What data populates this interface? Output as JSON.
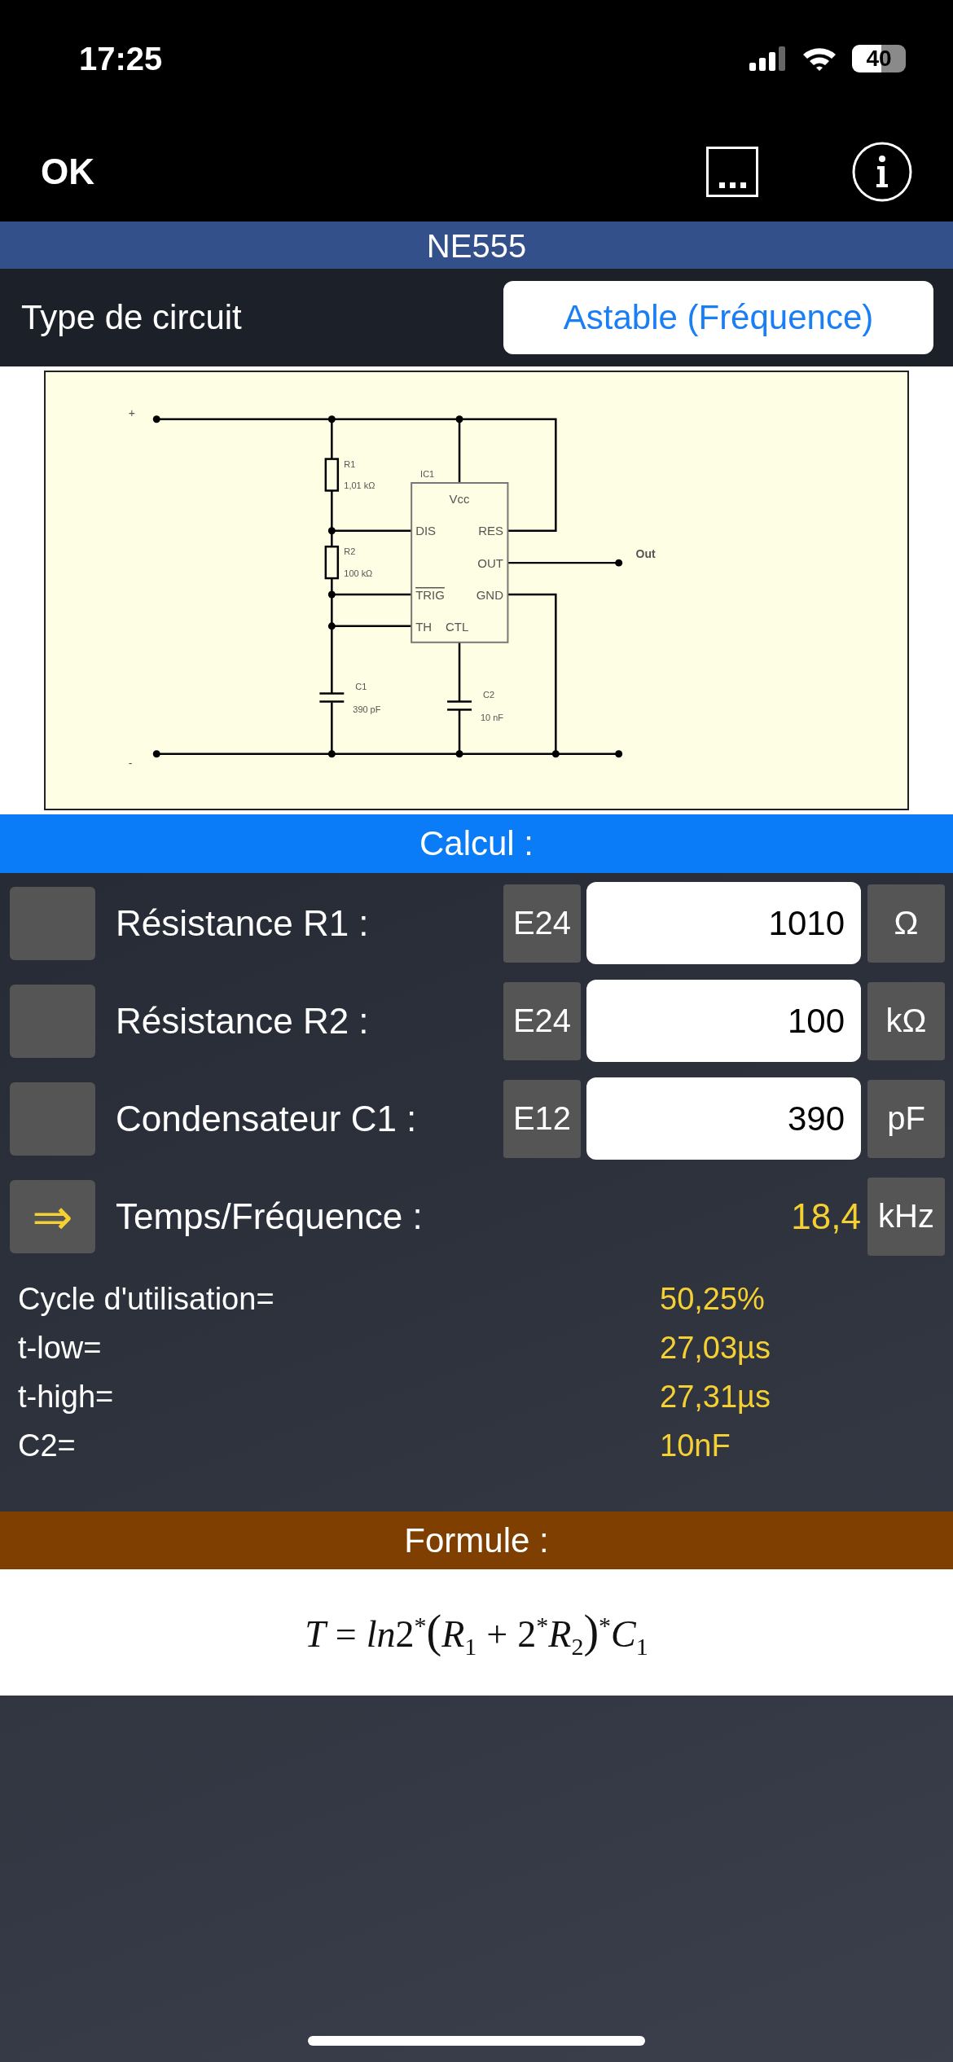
{
  "status_bar": {
    "time": "17:25",
    "battery": "40"
  },
  "nav_bar": {
    "ok": "OK"
  },
  "header": {
    "title": "NE555"
  },
  "circuit_type": {
    "label": "Type de circuit",
    "value": "Astable (Fréquence)"
  },
  "schematic": {
    "plus": "+",
    "minus": "-",
    "ic": "IC1",
    "out": "Out",
    "components": [
      {
        "kind": "resistor",
        "ref": "R1",
        "value": "1,01 kΩ"
      },
      {
        "kind": "resistor",
        "ref": "R2",
        "value": "100 kΩ"
      },
      {
        "kind": "capacitor",
        "ref": "C1",
        "value": "390 pF"
      },
      {
        "kind": "capacitor",
        "ref": "C2",
        "value": "10 nF"
      }
    ],
    "pins": [
      {
        "label": "Vcc",
        "inverted": false
      },
      {
        "label": "DIS",
        "inverted": false
      },
      {
        "label": "RES",
        "inverted": false
      },
      {
        "label": "OUT",
        "inverted": false
      },
      {
        "label": "TRIG",
        "inverted": true
      },
      {
        "label": "GND",
        "inverted": false
      },
      {
        "label": "TH",
        "inverted": false
      },
      {
        "label": "CTL",
        "inverted": false
      }
    ]
  },
  "calc": {
    "title": "Calcul :",
    "rows": [
      {
        "kind": "input",
        "label": "Résistance R1 :",
        "series": "E24",
        "value": "1010",
        "unit": "Ω"
      },
      {
        "kind": "input",
        "label": "Résistance R2 :",
        "series": "E24",
        "value": "100",
        "unit": "kΩ"
      },
      {
        "kind": "input",
        "label": "Condensateur C1 :",
        "series": "E12",
        "value": "390",
        "unit": "pF"
      },
      {
        "kind": "result",
        "button": "⇒",
        "label": "Temps/Fréquence :",
        "value": "18,4",
        "unit": "kHz"
      }
    ],
    "results": [
      {
        "label": "Cycle d'utilisation=",
        "value": "50,25%"
      },
      {
        "label": "t-low=",
        "value": "27,03µs"
      },
      {
        "label": "t-high=",
        "value": "27,31µs"
      },
      {
        "label": "C2=",
        "value": "10nF"
      }
    ]
  },
  "formula": {
    "title": "Formule :",
    "tokens": [
      {
        "kind": "var",
        "text": "T"
      },
      {
        "kind": "op",
        "text": "="
      },
      {
        "kind": "var",
        "text": "ln"
      },
      {
        "kind": "num",
        "text": "2"
      },
      {
        "kind": "sup",
        "text": "*"
      },
      {
        "kind": "paren",
        "text": "("
      },
      {
        "kind": "var",
        "text": "R"
      },
      {
        "kind": "sub",
        "text": "1"
      },
      {
        "kind": "op",
        "text": "+"
      },
      {
        "kind": "num",
        "text": "2"
      },
      {
        "kind": "sup",
        "text": "*"
      },
      {
        "kind": "var",
        "text": "R"
      },
      {
        "kind": "sub",
        "text": "2"
      },
      {
        "kind": "paren",
        "text": ")"
      },
      {
        "kind": "sup",
        "text": "*"
      },
      {
        "kind": "var",
        "text": "C"
      },
      {
        "kind": "sub",
        "text": "1"
      }
    ]
  }
}
